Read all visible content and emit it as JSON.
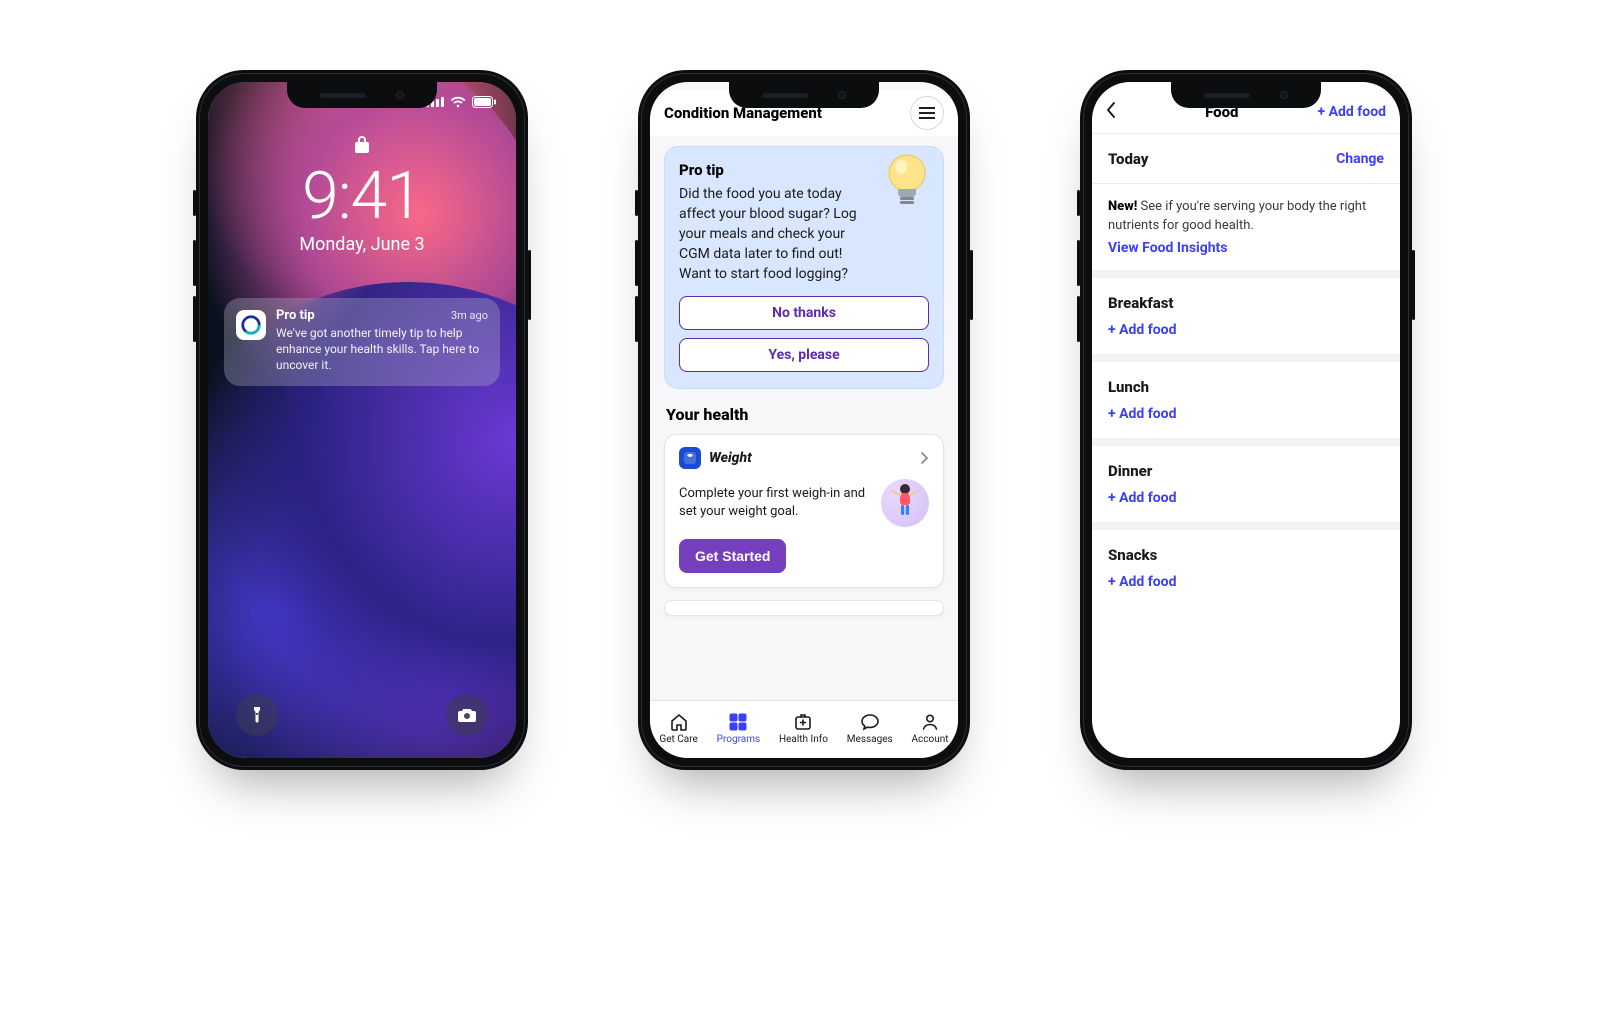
{
  "lock": {
    "time": "9:41",
    "date": "Monday, June 3",
    "notification": {
      "title": "Pro tip",
      "time": "3m ago",
      "body": "We've got another timely tip to help enhance your health skills. Tap here to uncover it."
    }
  },
  "app": {
    "header": {
      "title": "Condition Management"
    },
    "tip": {
      "heading": "Pro tip",
      "body": "Did the food you ate today affect your blood sugar? Log your meals and check your CGM data later to find out! Want to start food logging?",
      "no_label": "No thanks",
      "yes_label": "Yes, please"
    },
    "health": {
      "section_title": "Your health",
      "card": {
        "title": "Weight",
        "body": "Complete your first weigh-in and set your weight goal.",
        "cta": "Get Started"
      }
    },
    "tabs": [
      {
        "label": "Get Care"
      },
      {
        "label": "Programs"
      },
      {
        "label": "Health Info"
      },
      {
        "label": "Messages"
      },
      {
        "label": "Account"
      }
    ]
  },
  "food": {
    "header": {
      "title": "Food",
      "add_label": "+ Add food"
    },
    "subheader": {
      "date_label": "Today",
      "change_label": "Change"
    },
    "note_bold": "New!",
    "note_rest": " See if you're serving your body the right nutrients for good health.",
    "insights_link": "View Food Insights",
    "meals": [
      {
        "name": "Breakfast",
        "add": "+ Add food"
      },
      {
        "name": "Lunch",
        "add": "+ Add food"
      },
      {
        "name": "Dinner",
        "add": "+ Add food"
      },
      {
        "name": "Snacks",
        "add": "+ Add food"
      }
    ]
  }
}
